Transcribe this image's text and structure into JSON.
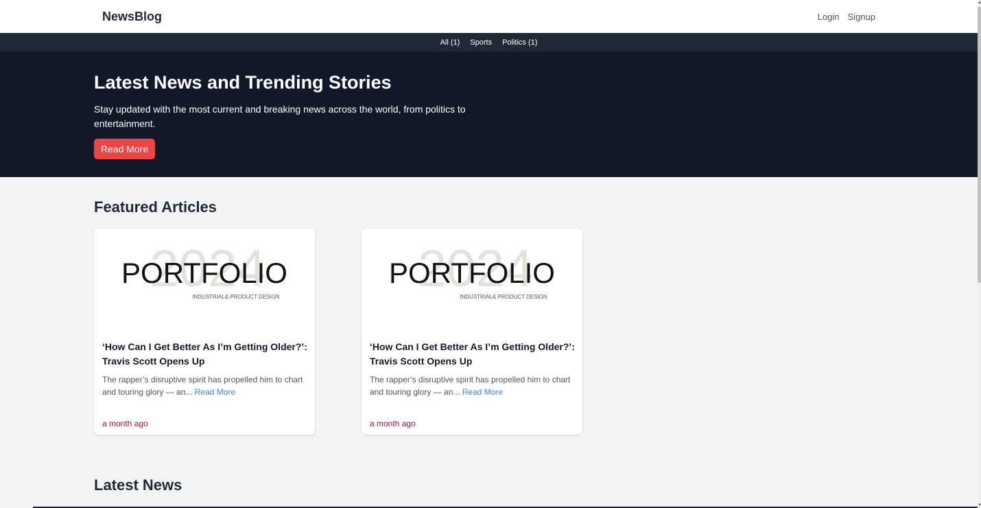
{
  "header": {
    "brand": "NewsBlog",
    "login": "Login",
    "signup": "Signup"
  },
  "categories": [
    "All (1)",
    "Sports",
    "Politics (1)"
  ],
  "hero": {
    "title": "Latest News and Trending Stories",
    "text": "Stay updated with the most current and breaking news across the world, from politics to entertainment.",
    "button": "Read More"
  },
  "featured": {
    "title": "Featured Articles",
    "articles": [
      {
        "image": {
          "year": "2024",
          "word": "PORTFOLIO",
          "caption": "INDUSTRIAL& PRODUCT  DESIGN"
        },
        "title": "‘How Can I Get Better As I’m Getting Older?’: Travis Scott Opens Up",
        "desc": "The rapper’s disruptive spirit has propelled him to chart and touring glory — an...",
        "link": "Read More",
        "time": "a month ago"
      },
      {
        "image": {
          "year": "2024",
          "word": "PORTFOLIO",
          "caption": "INDUSTRIAL& PRODUCT  DESIGN"
        },
        "title": "‘How Can I Get Better As I’m Getting Older?’: Travis Scott Opens Up",
        "desc": "The rapper’s disruptive spirit has propelled him to chart and touring glory — an...",
        "link": "Read More",
        "time": "a month ago"
      }
    ]
  },
  "latest": {
    "title": "Latest News"
  },
  "colors": {
    "hero_bg": "#111827",
    "catbar_bg": "#1f2937",
    "accent_button": "#ef4444",
    "link": "#3b82f6",
    "timestamp": "#9f1239"
  }
}
